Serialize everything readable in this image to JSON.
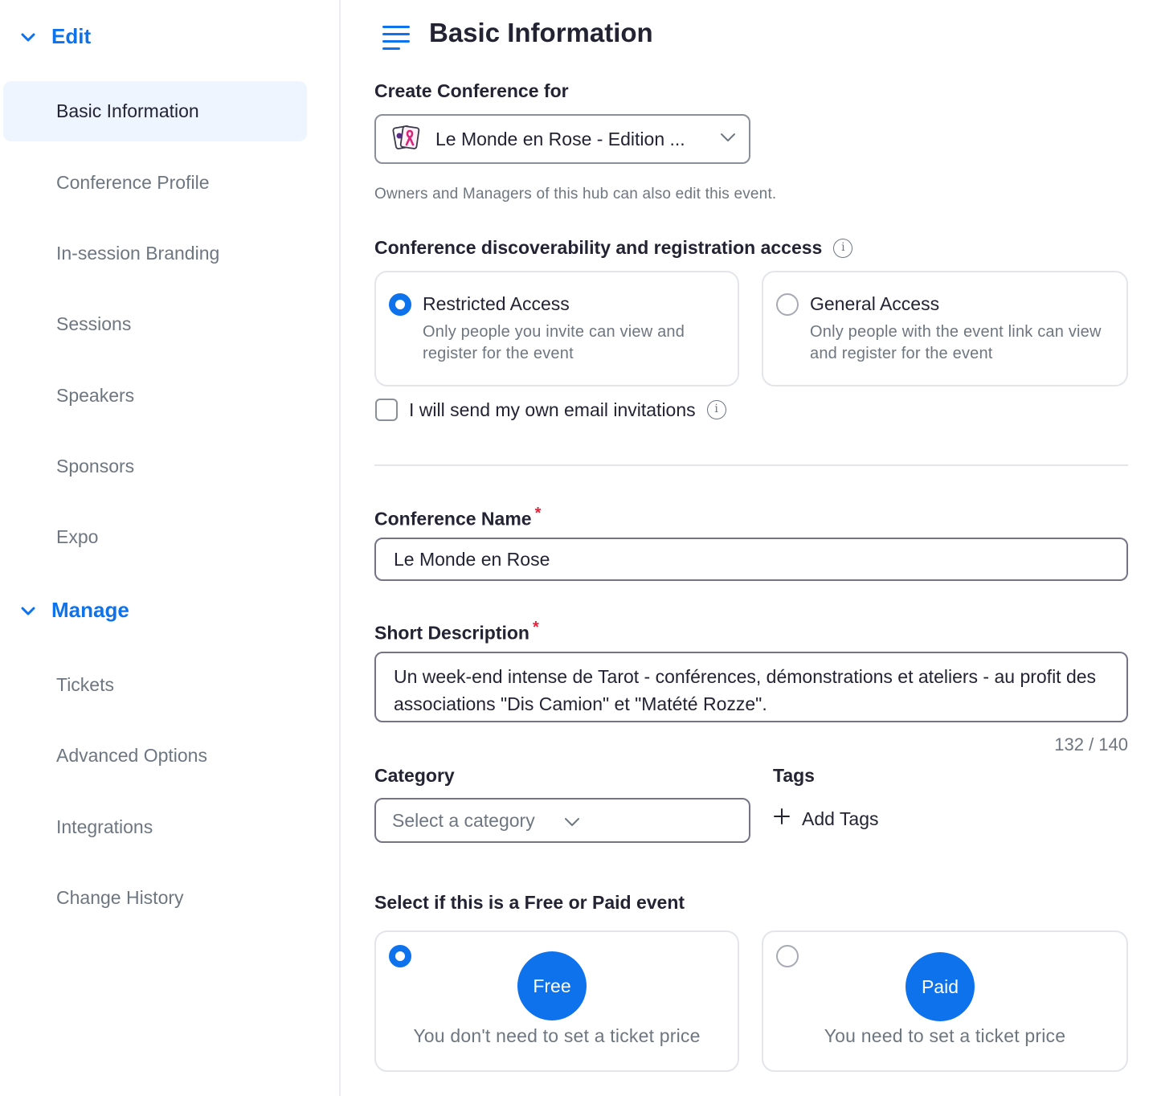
{
  "sidebar": {
    "edit_group": "Edit",
    "edit_items": [
      "Basic Information",
      "Conference Profile",
      "In-session Branding",
      "Sessions",
      "Speakers",
      "Sponsors",
      "Expo"
    ],
    "manage_group": "Manage",
    "manage_items": [
      "Tickets",
      "Advanced Options",
      "Integrations",
      "Change History"
    ],
    "active_item": "Basic Information"
  },
  "main": {
    "title": "Basic Information",
    "create_for_label": "Create Conference for",
    "hub_value": "Le Monde en Rose - Edition ...",
    "hub_hint": "Owners and Managers of this hub can also edit this event.",
    "access_label": "Conference discoverability and registration access",
    "access_options": [
      {
        "title": "Restricted Access",
        "desc": "Only people you invite can view and register for the event",
        "selected": true
      },
      {
        "title": "General Access",
        "desc": "Only people with the event link can view and register for the event",
        "selected": false
      }
    ],
    "own_email_label": "I will send my own email invitations",
    "own_email_checked": false,
    "name_label": "Conference Name",
    "name_value": "Le Monde en Rose",
    "desc_label": "Short Description",
    "desc_value": "Un week-end intense de Tarot - conférences, démonstrations et ateliers - au profit des associations \"Dis Camion\" et  \"Matété Rozze\".",
    "desc_counter": "132 / 140",
    "category_label": "Category",
    "category_placeholder": "Select a category",
    "tags_label": "Tags",
    "add_tags_label": "Add Tags",
    "price_label": "Select if this is a Free or Paid event",
    "price_options": [
      {
        "badge": "Free",
        "desc": "You don't need to set a ticket price",
        "selected": true
      },
      {
        "badge": "Paid",
        "desc": "You need to set a ticket price",
        "selected": false
      }
    ],
    "required_mark": "*",
    "info_glyph": "i"
  },
  "colors": {
    "accent": "#0e72ed",
    "active_bg": "#eef5fe",
    "required": "#e0263b",
    "muted_text": "#6e7680"
  }
}
